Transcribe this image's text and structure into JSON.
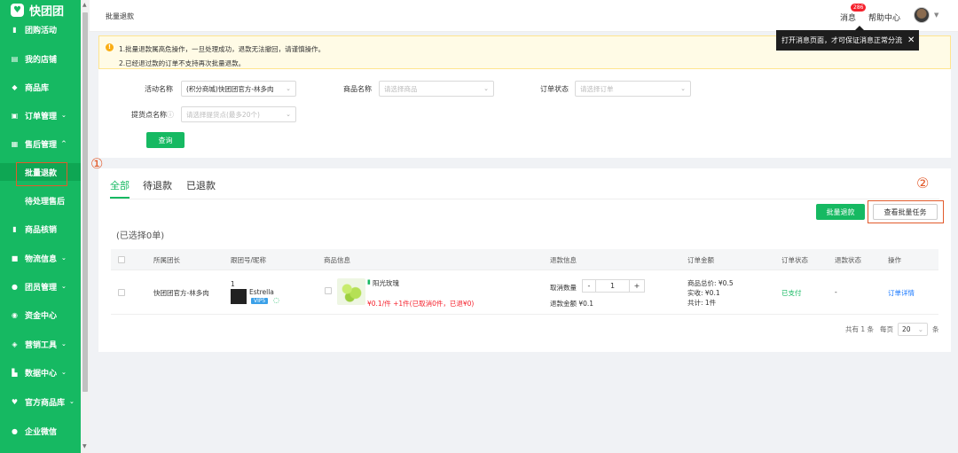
{
  "brand": {
    "name": "快团团",
    "color": "#16b962"
  },
  "sidebar": {
    "items": [
      {
        "label": "团购活动",
        "icon": "flag-icon",
        "chevron": ""
      },
      {
        "label": "我的店铺",
        "icon": "store-icon",
        "chevron": ""
      },
      {
        "label": "商品库",
        "icon": "box-icon",
        "chevron": ""
      },
      {
        "label": "订单管理",
        "icon": "order-icon",
        "chevron": "⌄"
      },
      {
        "label": "售后管理",
        "icon": "after-sale-icon",
        "chevron": "^"
      },
      {
        "label": "商品核销",
        "icon": "verify-icon",
        "chevron": ""
      },
      {
        "label": "物流信息",
        "icon": "truck-icon",
        "chevron": "⌄"
      },
      {
        "label": "团员管理",
        "icon": "user-icon",
        "chevron": "⌄"
      },
      {
        "label": "资金中心",
        "icon": "money-icon",
        "chevron": ""
      },
      {
        "label": "营销工具",
        "icon": "tag-icon",
        "chevron": "⌄"
      },
      {
        "label": "数据中心",
        "icon": "chart-icon",
        "chevron": "⌄"
      },
      {
        "label": "官方商品库",
        "icon": "heart-icon",
        "chevron": "⌄"
      },
      {
        "label": "企业微信",
        "icon": "wechat-icon",
        "chevron": ""
      }
    ],
    "subitems": [
      {
        "label": "批量退款"
      },
      {
        "label": "待处理售后"
      }
    ]
  },
  "topbar": {
    "breadcrumb": "批量退款",
    "messages_label": "消息",
    "messages_badge": "286",
    "help_label": "帮助中心"
  },
  "tooltip": {
    "text": "打开消息页面，才可保证消息正常分流",
    "close": "✕"
  },
  "notice": {
    "line1": "1.批量退款属高危操作，一旦处理成功，退款无法撤回，请谨慎操作。",
    "line2": "2.已经退过款的订单不支持再次批量退款。"
  },
  "filters": {
    "activity_label": "活动名称",
    "activity_value": "(积分商城)快团团官方-林多肉",
    "product_label": "商品名称",
    "product_placeholder": "请选择商品",
    "status_label": "订单状态",
    "status_placeholder": "请选择订单",
    "pickup_label": "提货点名称",
    "pickup_placeholder": "请选择提货点(最多20个)",
    "query_button": "查询"
  },
  "tabs": [
    {
      "label": "全部"
    },
    {
      "label": "待退款"
    },
    {
      "label": "已退款"
    }
  ],
  "actions": {
    "batch_refund": "批量退款",
    "view_tasks": "查看批量任务"
  },
  "selected_text": "(已选择0单)",
  "table": {
    "headers": [
      "所属团长",
      "跟团号/昵称",
      "商品信息",
      "退款信息",
      "订单金额",
      "订单状态",
      "退款状态",
      "操作"
    ],
    "rows": [
      {
        "leader": "快团团官方-林多肉",
        "group_no": "1",
        "nickname": "Estrella",
        "vip": "VIP5",
        "product_name": "阳光玫瑰",
        "price_line_a": "¥0.1/件 +1件(已取消",
        "cancelled": "0",
        "price_line_b": "件，已退",
        "refunded": "¥0",
        "price_line_c": ")",
        "cancel_qty_label": "取消数量",
        "qty_minus": "-",
        "qty_value": "1",
        "qty_plus": "+",
        "refund_amount": "退款金额 ¥0.1",
        "amount_total": "商品总价: ¥0.5",
        "amount_paid": "实收: ¥0.1",
        "amount_count": "共计: 1件",
        "order_status": "已支付",
        "refund_status": "-",
        "action": "订单详情"
      }
    ]
  },
  "pagination": {
    "total": "共有 1 条",
    "per_page_label": "每页",
    "per_page_value": "20",
    "per_page_unit": "条"
  },
  "annotations": {
    "one": "①",
    "two": "②"
  }
}
